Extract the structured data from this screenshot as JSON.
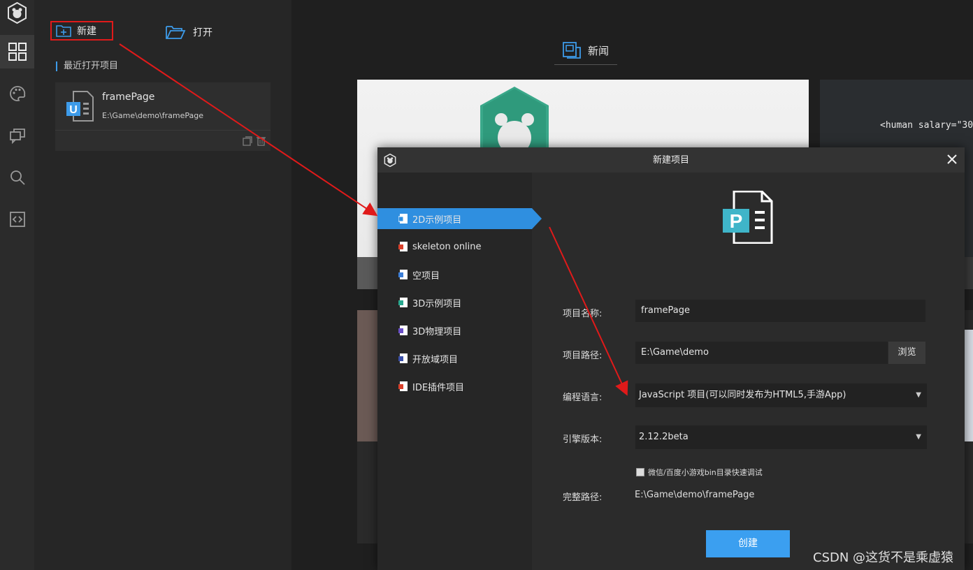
{
  "sidebar_rail": {
    "items": [
      {
        "icon": "layabox-logo-icon"
      },
      {
        "icon": "grid-icon",
        "active": true
      },
      {
        "icon": "palette-icon"
      },
      {
        "icon": "chat-icon"
      },
      {
        "icon": "search-icon"
      },
      {
        "icon": "code-icon"
      }
    ]
  },
  "project_panel": {
    "new_label": "新建",
    "open_label": "打开",
    "recent_title": "最近打开项目",
    "recent": [
      {
        "name": "framePage",
        "path": "E:\\Game\\demo\\framePage"
      }
    ]
  },
  "news": {
    "tab_label": "新闻",
    "code_snippet": "<human salary=\"30"
  },
  "dialog": {
    "title": "新建项目",
    "templates": [
      {
        "label": "2D示例项目",
        "selected": true
      },
      {
        "label": "skeleton online"
      },
      {
        "label": "空项目"
      },
      {
        "label": "3D示例项目"
      },
      {
        "label": "3D物理项目"
      },
      {
        "label": "开放域项目"
      },
      {
        "label": "IDE插件项目"
      }
    ],
    "form": {
      "name_label": "项目名称:",
      "name_value": "framePage",
      "path_label": "项目路径:",
      "path_value": "E:\\Game\\demo",
      "browse_label": "浏览",
      "lang_label": "编程语言:",
      "lang_value": "JavaScript 项目(可以同时发布为HTML5,手游App)",
      "engine_label": "引擎版本:",
      "engine_value": "2.12.2beta",
      "wechat_checkbox_label": "微信/百度小游戏bin目录快速调试",
      "wechat_checked": false,
      "fullpath_label": "完整路径:",
      "fullpath_value": "E:\\Game\\demo\\framePage"
    },
    "create_label": "创建"
  },
  "watermark": "CSDN @这货不是乘虚猿",
  "colors": {
    "accent": "#3b9ff0",
    "annotation_red": "#e01a1a",
    "selected_template": "#2f8fe0"
  }
}
